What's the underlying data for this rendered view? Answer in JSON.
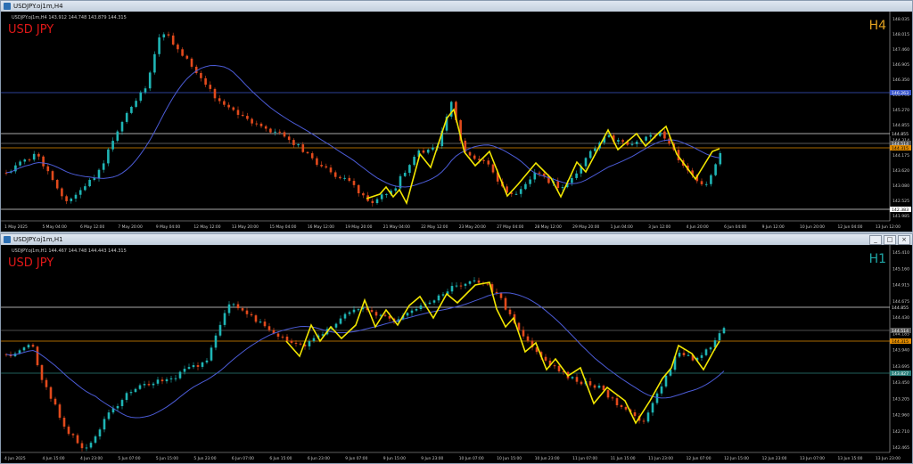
{
  "windows": [
    {
      "title": "USDJPY.oj1m,H4",
      "info": "USDJPY.oj1m,H4  143.912 144.748 143.879 144.315",
      "symbol_label": "USD JPY",
      "timeframe": "H4",
      "timeframe_color": "#e0a020",
      "price_labels": [
        "148.035",
        "148.015",
        "147.460",
        "146.905",
        "146.350",
        "145.795",
        "145.270",
        "144.855",
        "144.314",
        "144.175",
        "143.620",
        "143.080",
        "142.525",
        "141.985"
      ],
      "marked_prices": {
        "blue": "146.263",
        "white_top": "144.855",
        "gray": "144.514",
        "orange": "144.315",
        "white_bottom": "142.383"
      },
      "time_labels": [
        "1 May 2025",
        "5 May 04:00",
        "6 May 12:00",
        "7 May 20:00",
        "9 May 04:00",
        "12 May 12:00",
        "13 May 20:00",
        "15 May 04:00",
        "16 May 12:00",
        "19 May 20:00",
        "21 May 04:00",
        "22 May 12:00",
        "23 May 20:00",
        "27 May 04:00",
        "28 May 12:00",
        "29 May 20:00",
        "1 Jun 04:00",
        "3 Jun 12:00",
        "4 Jun 20:00",
        "6 Jun 04:00",
        "9 Jun 12:00",
        "10 Jun 20:00",
        "12 Jun 04:00",
        "13 Jun 12:00"
      ]
    },
    {
      "title": "USDJPY.oj1m,H1",
      "info": "USDJPY.oj1m,H1  144.467 144.748 144.443 144.315",
      "symbol_label": "USD JPY",
      "timeframe": "H1",
      "timeframe_color": "#1fa6a6",
      "buttons": [
        "_",
        "□",
        "×"
      ],
      "price_labels": [
        "145.410",
        "145.160",
        "144.915",
        "144.675",
        "144.430",
        "144.185",
        "143.940",
        "143.695",
        "143.450",
        "143.205",
        "142.960",
        "142.710",
        "142.465"
      ],
      "marked_prices": {
        "white_top": "144.855",
        "gray": "144.514",
        "orange": "144.315",
        "teal": "143.827"
      },
      "time_labels": [
        "4 Jun 2025",
        "4 Jun 15:00",
        "4 Jun 23:00",
        "5 Jun 07:00",
        "5 Jun 15:00",
        "5 Jun 23:00",
        "6 Jun 07:00",
        "6 Jun 15:00",
        "6 Jun 23:00",
        "9 Jun 07:00",
        "9 Jun 15:00",
        "9 Jun 23:00",
        "10 Jun 07:00",
        "10 Jun 15:00",
        "10 Jun 23:00",
        "11 Jun 07:00",
        "11 Jun 15:00",
        "11 Jun 23:00",
        "12 Jun 07:00",
        "12 Jun 15:00",
        "12 Jun 23:00",
        "13 Jun 07:00",
        "13 Jun 15:00",
        "13 Jun 23:00"
      ]
    }
  ],
  "colors": {
    "bull": "#1fb5b5",
    "bear": "#e24a1c",
    "ma": "#4b5bd6",
    "zigzag": "#f2e600",
    "text": "#c8c8c8",
    "label_red": "#e01818"
  }
}
